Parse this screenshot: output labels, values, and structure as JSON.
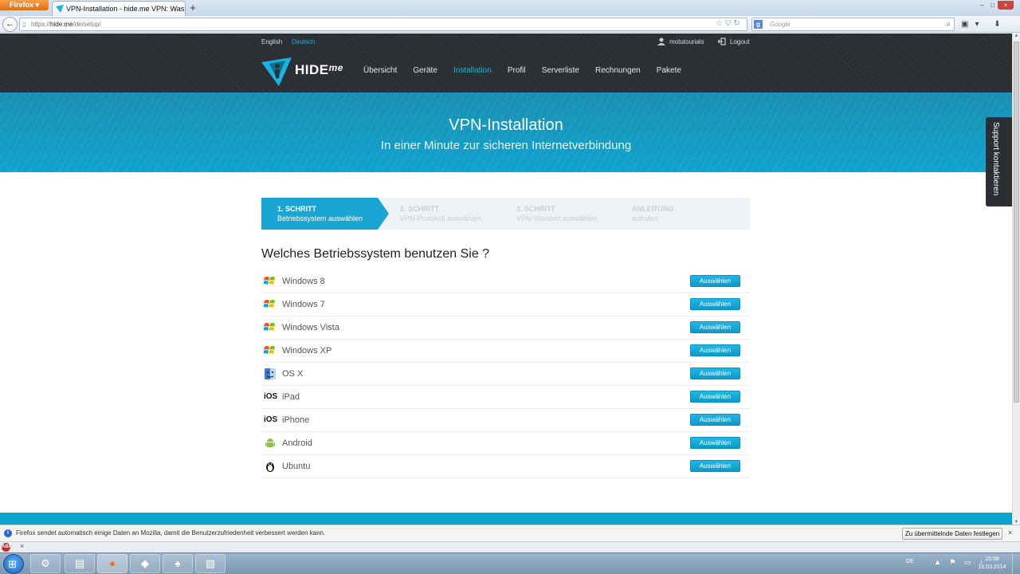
{
  "browser": {
    "menu_label": "Firefox",
    "tab_title": "VPN-Installation - hide.me VPN: Was ka...",
    "tab_close": "×",
    "new_tab": "+",
    "window_controls": [
      "–",
      "□",
      "×"
    ],
    "back": "←",
    "url_scheme": "https://",
    "url_host": "hide.me",
    "url_path": "/de/setup/",
    "url_icons": "☆ ▽ ↻",
    "search_placeholder": "Google",
    "search_engine_glyph": "g",
    "search_icon": "⌕",
    "toolbar_icons": "▣▾ ⬇ ⌂"
  },
  "site": {
    "languages": [
      "English",
      "Deutsch"
    ],
    "active_language": "Deutsch",
    "username": "motutourials",
    "logout": "Logout",
    "logo_text": "HIDE",
    "logo_suffix": "me",
    "nav": [
      {
        "label": "Übersicht",
        "active": false
      },
      {
        "label": "Geräte",
        "active": false
      },
      {
        "label": "Installation",
        "active": true
      },
      {
        "label": "Profil",
        "active": false
      },
      {
        "label": "Serverliste",
        "active": false
      },
      {
        "label": "Rechnungen",
        "active": false
      },
      {
        "label": "Pakete",
        "active": false
      }
    ],
    "accent_color": "#19b3e6"
  },
  "hero": {
    "title": "VPN-Installation",
    "subtitle": "In einer Minute zur sicheren Internetverbindung"
  },
  "support_tab": "Support kontaktieren",
  "steps": [
    {
      "title": "1. SCHRITT",
      "subtitle": "Betriebssystem auswählen",
      "active": true
    },
    {
      "title": "2. SCHRITT",
      "subtitle": "VPN-Protokoll auswählen",
      "active": false
    },
    {
      "title": "3. SCHRITT",
      "subtitle": "VPN-Standort auswählen",
      "active": false
    },
    {
      "title": "ANLEITUNG",
      "subtitle": "aufrufen",
      "active": false
    }
  ],
  "question": "Welches Betriebssystem benutzen Sie ?",
  "os_list": [
    {
      "name": "Windows 8",
      "icon": "windows-icon",
      "button": "Auswählen"
    },
    {
      "name": "Windows 7",
      "icon": "windows-icon",
      "button": "Auswählen"
    },
    {
      "name": "Windows Vista",
      "icon": "windows-icon",
      "button": "Auswählen"
    },
    {
      "name": "Windows XP",
      "icon": "windows-icon",
      "button": "Auswählen"
    },
    {
      "name": "OS X",
      "icon": "mac-finder-icon",
      "button": "Auswählen"
    },
    {
      "name": "iPad",
      "icon": "ios-icon",
      "button": "Auswählen"
    },
    {
      "name": "iPhone",
      "icon": "ios-icon",
      "button": "Auswählen"
    },
    {
      "name": "Android",
      "icon": "android-icon",
      "button": "Auswählen"
    },
    {
      "name": "Ubuntu",
      "icon": "linux-tux-icon",
      "button": "Auswählen"
    }
  ],
  "ios_label": "iOS",
  "notification": {
    "icon": "i",
    "text": "Firefox sendet automatisch einige Daten an Mozilla, damit die Benutzerzufriedenheit verbessert werden kann.",
    "button": "Zu übermittelnde Daten festlegen",
    "close": "×"
  },
  "addon_bar": {
    "abp": "ABP",
    "close": "×"
  },
  "taskbar": {
    "start_glyph": "⊞",
    "apps": [
      {
        "name": "taskbar-explorer-icon",
        "glyph": "▤"
      },
      {
        "name": "taskbar-firefox-icon",
        "glyph": "●"
      },
      {
        "name": "taskbar-app3-icon",
        "glyph": "◆"
      },
      {
        "name": "taskbar-app4-icon",
        "glyph": "♠"
      },
      {
        "name": "taskbar-app5-icon",
        "glyph": "▧"
      }
    ],
    "language": "DE",
    "tray_icons": "▲ ⚑ ▭ ♪",
    "time": "15:58",
    "date": "16.03.2014"
  }
}
